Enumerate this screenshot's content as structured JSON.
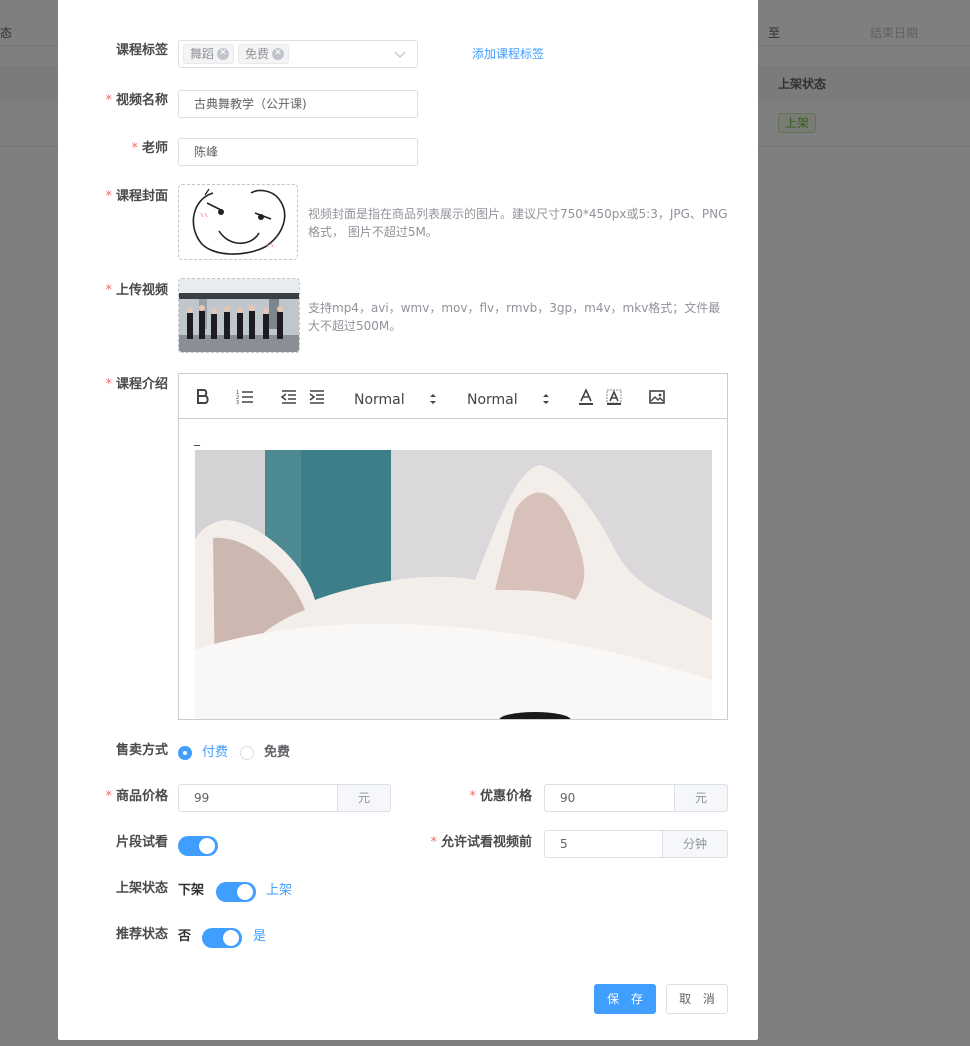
{
  "background": {
    "left_cell": "态",
    "to_label": "至",
    "end_date_placeholder": "结束日期",
    "status_column": "上架状态",
    "status_tag": "上架"
  },
  "form": {
    "course_tags": {
      "label": "课程标签",
      "tags": [
        "舞蹈",
        "免费"
      ],
      "add_link": "添加课程标签"
    },
    "video_name": {
      "label": "视频名称",
      "value": "古典舞教学（公开课)"
    },
    "teacher": {
      "label": "老师",
      "value": "陈峰"
    },
    "cover": {
      "label": "课程封面",
      "tip": "视频封面是指在商品列表展示的图片。建议尺寸750*450px或5:3，JPG、PNG格式， 图片不超过5M。"
    },
    "upload_video": {
      "label": "上传视频",
      "tip": "支持mp4，avi，wmv，mov，flv，rmvb，3gp，m4v，mkv格式；文件最大不超过500M。"
    },
    "intro": {
      "label": "课程介绍",
      "toolbar": {
        "size_select": "Normal",
        "header_select": "Normal"
      },
      "content_mark": "_"
    },
    "sale_method": {
      "label": "售卖方式",
      "options": [
        "付费",
        "免费"
      ],
      "selected": "付费"
    },
    "price": {
      "label": "商品价格",
      "value": "99",
      "unit": "元"
    },
    "discount_price": {
      "label": "优惠价格",
      "value": "90",
      "unit": "元"
    },
    "trial": {
      "label": "片段试看",
      "enabled": true
    },
    "trial_minutes": {
      "label": "允许试看视频前",
      "value": "5",
      "unit": "分钟"
    },
    "shelf_status": {
      "label": "上架状态",
      "inactive_text": "下架",
      "active_text": "上架",
      "enabled": true
    },
    "recommend_status": {
      "label": "推荐状态",
      "inactive_text": "否",
      "active_text": "是",
      "enabled": true
    }
  },
  "actions": {
    "save": "保 存",
    "cancel": "取 消"
  },
  "colors": {
    "primary": "#409eff",
    "required": "#f56c6c",
    "success": "#67c23a"
  }
}
